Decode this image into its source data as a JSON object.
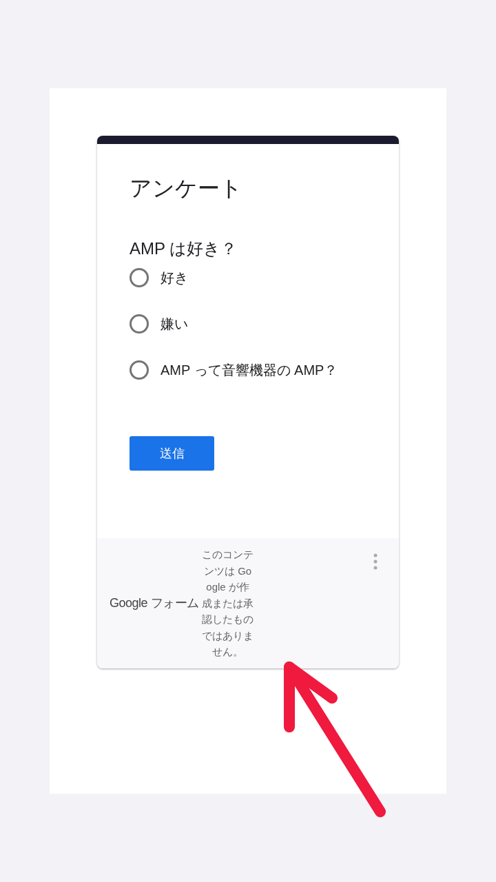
{
  "form": {
    "title": "アンケート",
    "question": "AMP は好き？",
    "options": [
      {
        "label": "好き",
        "selected": false
      },
      {
        "label": "嫌い",
        "selected": false
      },
      {
        "label": "AMP って音響機器の AMP？",
        "selected": false
      }
    ],
    "submit": "送信"
  },
  "footer": {
    "brand": "Google",
    "product": "フォーム",
    "disclaimer": "このコンテンツは Google が作成または承認したものではありません。"
  }
}
